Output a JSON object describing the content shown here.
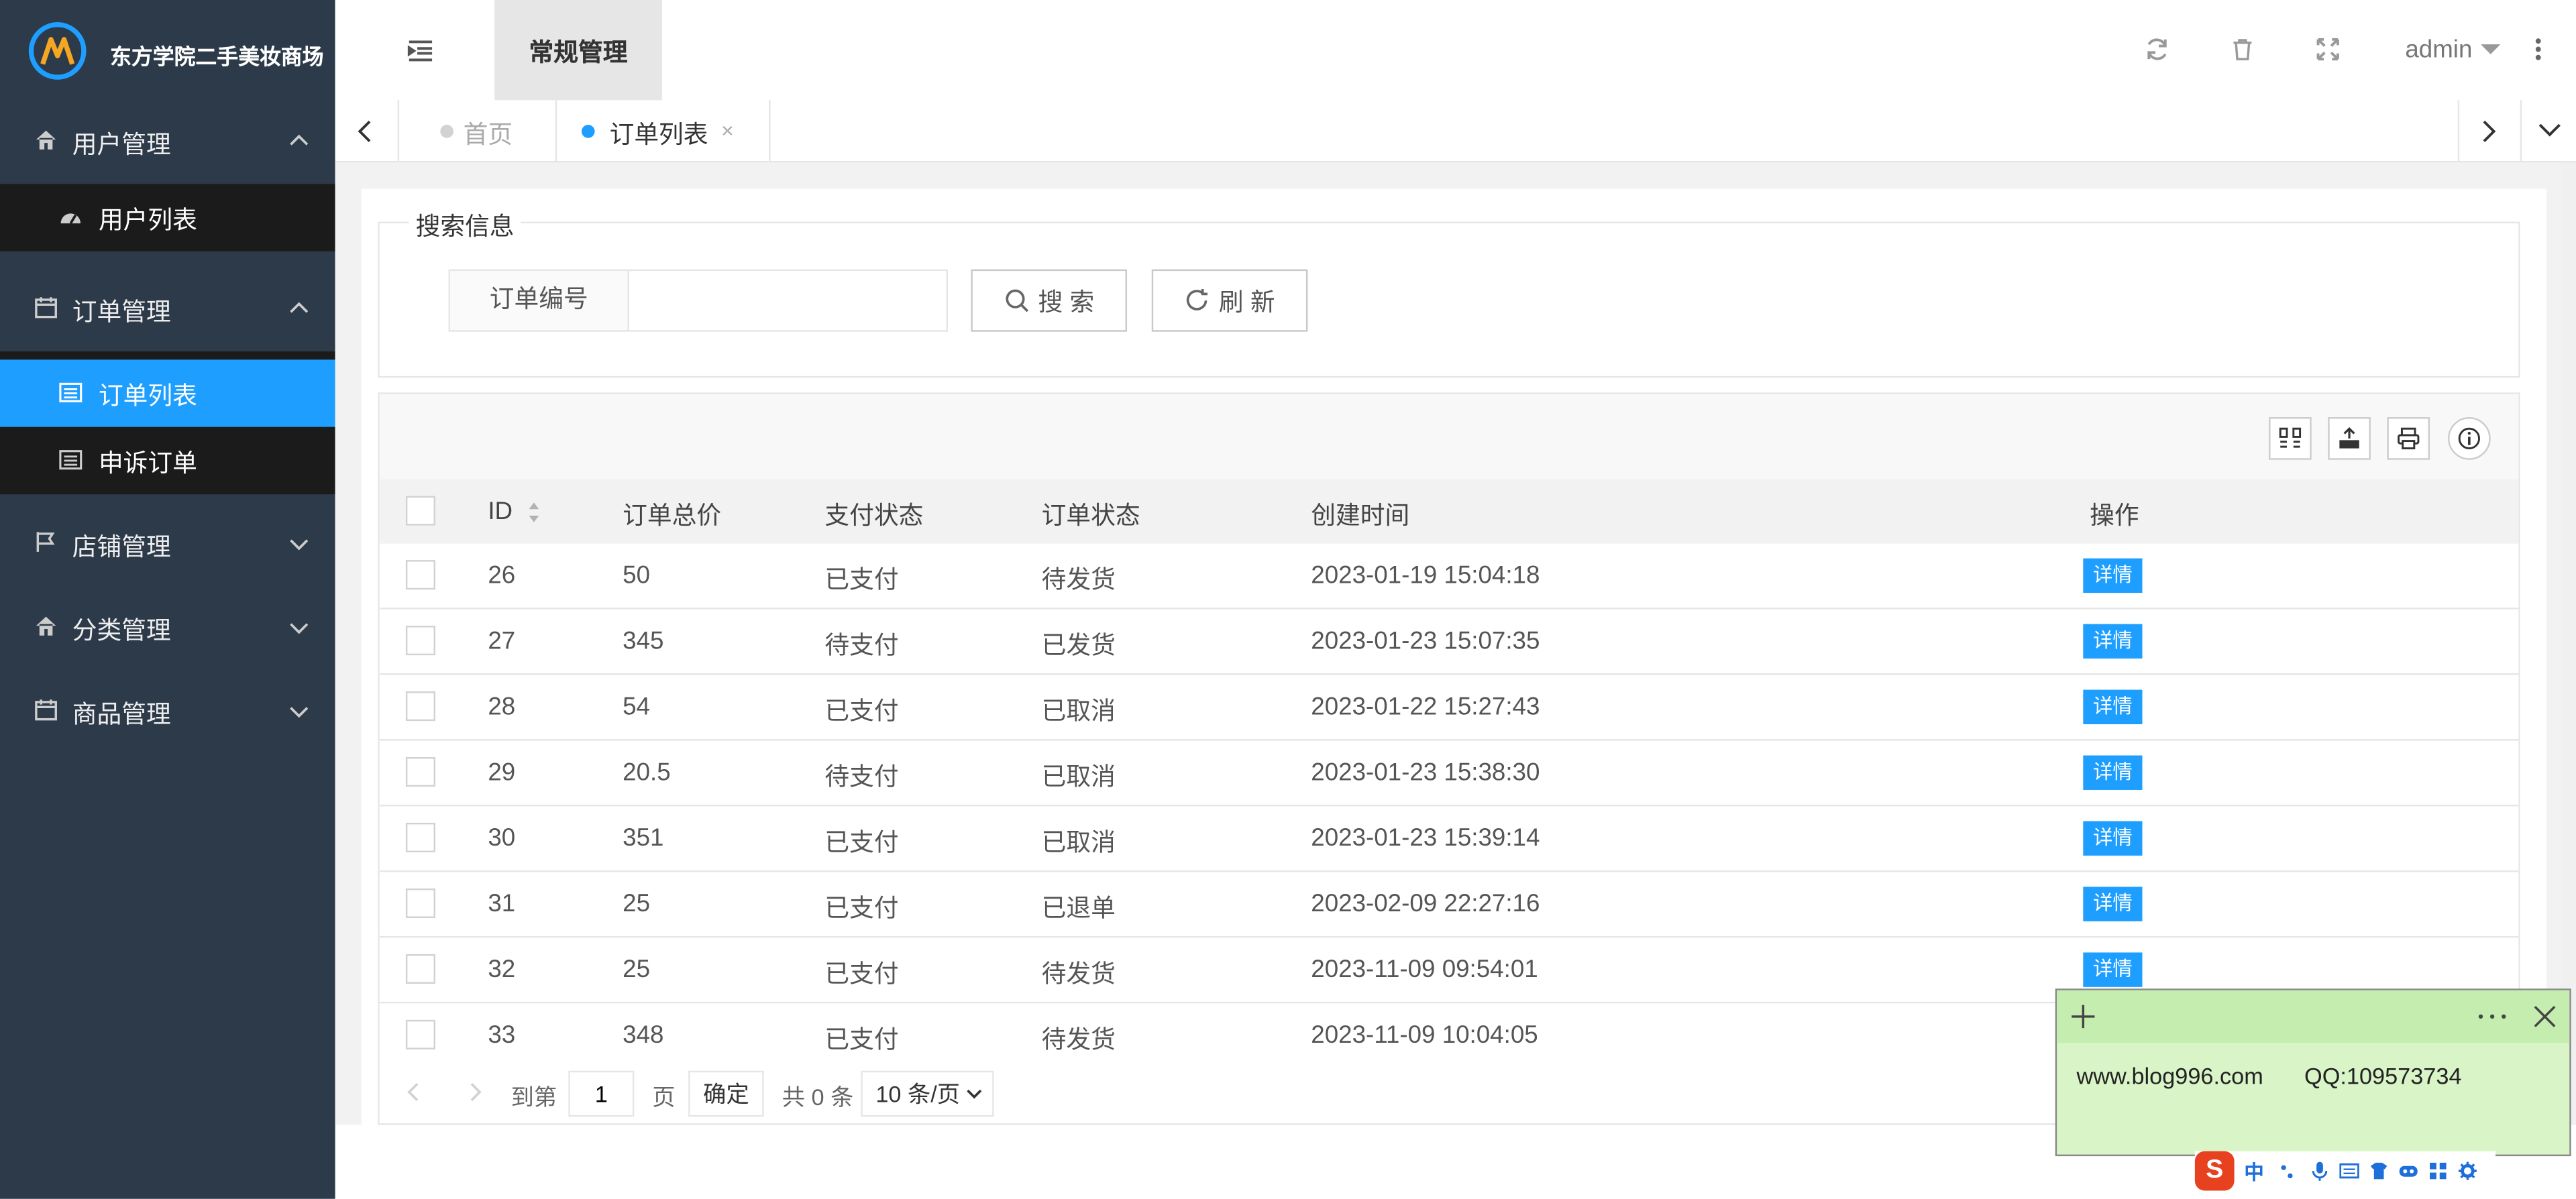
{
  "app": {
    "title": "东方学院二手美妆商场"
  },
  "sidebar": {
    "groups": [
      {
        "label": "用户管理",
        "expanded": true,
        "icon": "home-icon",
        "items": [
          "用户列表"
        ]
      },
      {
        "label": "订单管理",
        "expanded": true,
        "icon": "calendar-icon",
        "items": [
          "订单列表",
          "申诉订单"
        ]
      },
      {
        "label": "店铺管理",
        "expanded": false,
        "icon": "flag-icon"
      },
      {
        "label": "分类管理",
        "expanded": false,
        "icon": "home-icon"
      },
      {
        "label": "商品管理",
        "expanded": false,
        "icon": "calendar-icon"
      }
    ],
    "active_item": "订单列表"
  },
  "header": {
    "tab_label": "常规管理",
    "user": "admin"
  },
  "tabs": [
    {
      "label": "首页",
      "active": false
    },
    {
      "label": "订单列表",
      "active": true,
      "close": "×"
    }
  ],
  "search": {
    "legend": "搜索信息",
    "field_label": "订单编号",
    "field_value": "",
    "search_label": "搜 索",
    "refresh_label": "刷 新"
  },
  "table": {
    "columns": [
      "ID",
      "订单总价",
      "支付状态",
      "订单状态",
      "创建时间",
      "操作"
    ],
    "rows": [
      {
        "id": "26",
        "total": "50",
        "pay": "已支付",
        "status": "待发货",
        "created": "2023-01-19 15:04:18",
        "action": "详情"
      },
      {
        "id": "27",
        "total": "345",
        "pay": "待支付",
        "status": "已发货",
        "created": "2023-01-23 15:07:35",
        "action": "详情"
      },
      {
        "id": "28",
        "total": "54",
        "pay": "已支付",
        "status": "已取消",
        "created": "2023-01-22 15:27:43",
        "action": "详情"
      },
      {
        "id": "29",
        "total": "20.5",
        "pay": "待支付",
        "status": "已取消",
        "created": "2023-01-23 15:38:30",
        "action": "详情"
      },
      {
        "id": "30",
        "total": "351",
        "pay": "已支付",
        "status": "已取消",
        "created": "2023-01-23 15:39:14",
        "action": "详情"
      },
      {
        "id": "31",
        "total": "25",
        "pay": "已支付",
        "status": "已退单",
        "created": "2023-02-09 22:27:16",
        "action": "详情"
      },
      {
        "id": "32",
        "total": "25",
        "pay": "已支付",
        "status": "待发货",
        "created": "2023-11-09 09:54:01",
        "action": "详情"
      },
      {
        "id": "33",
        "total": "348",
        "pay": "已支付",
        "status": "待发货",
        "created": "2023-11-09 10:04:05",
        "action": "详情"
      }
    ]
  },
  "pager": {
    "goto_label": "到第",
    "page": "1",
    "page_suffix": "页",
    "confirm": "确定",
    "total": "共 0 条",
    "page_size": "10 条/页"
  },
  "note": {
    "url": "www.blog996.com",
    "qq": "QQ:109573734"
  },
  "ime": {
    "mode": "中"
  },
  "colors": {
    "sidebar_bg": "#2d3a4a",
    "active": "#1e9fff",
    "submenu_bg": "#1b1b1b"
  }
}
